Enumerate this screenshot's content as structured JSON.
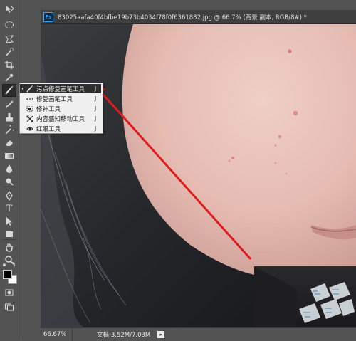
{
  "document": {
    "tab_title": "83025aafa40f4bfbe19b73b4034f78f0f6361882.jpg @ 66.7% (背景 副本, RGB/8#) *",
    "app_badge": "Ps"
  },
  "status_bar": {
    "zoom": "66.67%",
    "doc_info": "文档:3.52M/7.03M",
    "arrow": "▸"
  },
  "flyout_menu": {
    "items": [
      {
        "label": "污点修复画笔工具",
        "shortcut": "J",
        "icon": "spot-healing-brush-icon",
        "selected": true,
        "bullet": "•"
      },
      {
        "label": "修复画笔工具",
        "shortcut": "J",
        "icon": "healing-brush-icon",
        "selected": false,
        "bullet": ""
      },
      {
        "label": "修补工具",
        "shortcut": "J",
        "icon": "patch-icon",
        "selected": false,
        "bullet": ""
      },
      {
        "label": "内容感知移动工具",
        "shortcut": "J",
        "icon": "content-aware-move-icon",
        "selected": false,
        "bullet": ""
      },
      {
        "label": "红眼工具",
        "shortcut": "J",
        "icon": "red-eye-icon",
        "selected": false,
        "bullet": ""
      }
    ]
  },
  "toolbar": {
    "tools": [
      "move-icon",
      "marquee-icon",
      "lasso-icon",
      "quick-selection-icon",
      "crop-icon",
      "eyedropper-icon",
      "spot-healing-brush-icon",
      "brush-icon",
      "clone-stamp-icon",
      "history-brush-icon",
      "eraser-icon",
      "gradient-icon",
      "blur-icon",
      "dodge-icon",
      "pen-icon",
      "type-icon",
      "path-selection-icon",
      "rectangle-icon",
      "hand-icon",
      "zoom-icon"
    ],
    "foreground_color": "#000000",
    "background_color": "#ffffff"
  },
  "colors": {
    "annotation_arrow": "#e01b1b",
    "menu_highlight": "#2e2e2e",
    "app_chrome": "#535353"
  }
}
